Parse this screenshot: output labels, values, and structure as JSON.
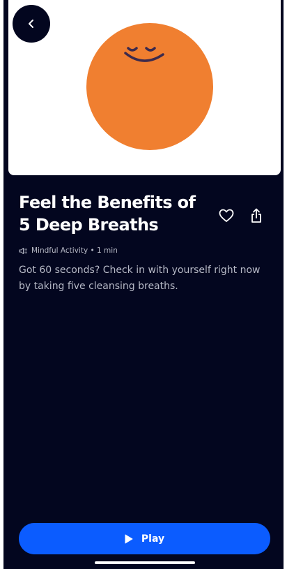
{
  "header": {
    "back_icon": "chevron-left-icon",
    "hero_illustration": "smiling-orange-orb"
  },
  "content": {
    "title": "Feel the Benefits of 5 Deep Breaths",
    "meta": "Mindful Activity • 1 min",
    "meta_icon": "speaker-icon",
    "description": "Got 60 seconds? Check in with yourself right now by taking five cleansing breaths."
  },
  "actions": {
    "favorite_icon": "heart-icon",
    "share_icon": "share-icon"
  },
  "player": {
    "play_label": "Play",
    "play_icon": "play-icon"
  },
  "colors": {
    "background": "#03061f",
    "orb": "#f07f30",
    "accent": "#0b5cff",
    "text_muted": "#b6b9c6"
  }
}
